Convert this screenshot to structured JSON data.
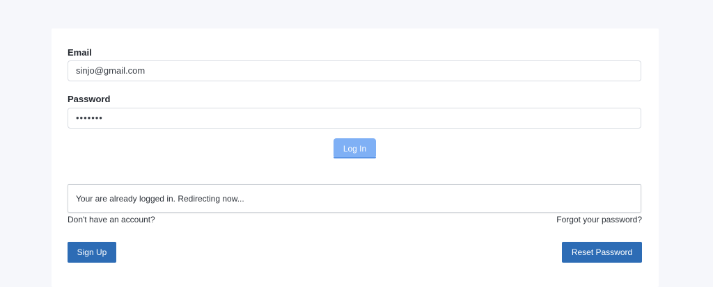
{
  "form": {
    "email_label": "Email",
    "email_value": "sinjo@gmail.com",
    "password_label": "Password",
    "password_value_masked": "•••••••",
    "login_label": "Log In"
  },
  "status": {
    "message": "Your are already logged in. Redirecting now..."
  },
  "footer": {
    "no_account_text": "Don't have an account?",
    "forgot_text": "Forgot your password?",
    "signup_label": "Sign Up",
    "reset_label": "Reset Password"
  },
  "colors": {
    "page_bg": "#f6f7fb",
    "card_bg": "#ffffff",
    "primary_button": "#2d6cb5",
    "login_button_disabled": "#7fb0f5"
  }
}
